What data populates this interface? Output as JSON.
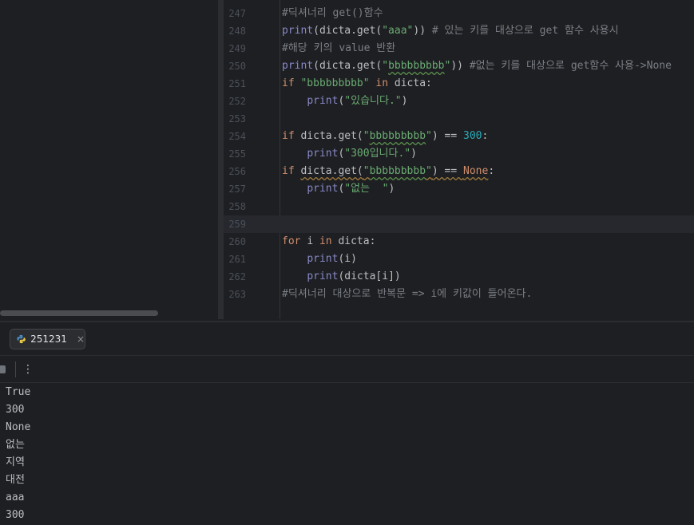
{
  "editor": {
    "lines": [
      {
        "n": "247",
        "tokens": [
          [
            "cm",
            "#딕셔너리 get()함수"
          ]
        ]
      },
      {
        "n": "248",
        "tokens": [
          [
            "fn",
            "print"
          ],
          [
            "",
            "(dicta.get("
          ],
          [
            "st",
            "\"aaa\""
          ],
          [
            "",
            ")) "
          ],
          [
            "cm",
            "# 있는 키를 대상으로 get 함수 사용시"
          ]
        ]
      },
      {
        "n": "249",
        "tokens": [
          [
            "cm",
            "#해당 키의 value 반환"
          ]
        ]
      },
      {
        "n": "250",
        "tokens": [
          [
            "fn",
            "print"
          ],
          [
            "",
            "(dicta.get("
          ],
          [
            "st",
            "\""
          ],
          [
            "st sq",
            "bbbbbbbbb"
          ],
          [
            "st",
            "\""
          ],
          [
            "",
            ")) "
          ],
          [
            "cm",
            "#없는 키를 대상으로 get함수 사용->None"
          ]
        ]
      },
      {
        "n": "251",
        "tokens": [
          [
            "kw",
            "if "
          ],
          [
            "st",
            "\"bbbbbbbbb\""
          ],
          [
            "kw",
            " in "
          ],
          [
            "",
            "dicta:"
          ]
        ]
      },
      {
        "n": "252",
        "tokens": [
          [
            "",
            "    "
          ],
          [
            "fn",
            "print"
          ],
          [
            "",
            "("
          ],
          [
            "st",
            "\"있습니다.\""
          ],
          [
            "",
            ")"
          ]
        ]
      },
      {
        "n": "253",
        "tokens": []
      },
      {
        "n": "254",
        "tokens": [
          [
            "kw",
            "if "
          ],
          [
            "",
            "dicta.get("
          ],
          [
            "st",
            "\""
          ],
          [
            "st sq",
            "bbbbbbbbb"
          ],
          [
            "st",
            "\""
          ],
          [
            "",
            ") == "
          ],
          [
            "nb",
            "300"
          ],
          [
            "",
            ":"
          ]
        ]
      },
      {
        "n": "255",
        "tokens": [
          [
            "",
            "    "
          ],
          [
            "fn",
            "print"
          ],
          [
            "",
            "("
          ],
          [
            "st",
            "\"300입니다.\""
          ],
          [
            "",
            ")"
          ]
        ]
      },
      {
        "n": "256",
        "tokens": [
          [
            "kw",
            "if "
          ],
          [
            "wq",
            "dicta.get("
          ],
          [
            "st wq",
            "\""
          ],
          [
            "st sq",
            "bbbbbbbbb"
          ],
          [
            "st wq",
            "\""
          ],
          [
            "wq",
            ") == "
          ],
          [
            "kw wq",
            "None"
          ],
          [
            "",
            ":"
          ]
        ]
      },
      {
        "n": "257",
        "tokens": [
          [
            "",
            "    "
          ],
          [
            "fn",
            "print"
          ],
          [
            "",
            "("
          ],
          [
            "st",
            "\"없는  \""
          ],
          [
            "",
            ")"
          ]
        ]
      },
      {
        "n": "258",
        "tokens": []
      },
      {
        "n": "259",
        "tokens": [],
        "current": true
      },
      {
        "n": "260",
        "tokens": [
          [
            "kw",
            "for "
          ],
          [
            "",
            "i"
          ],
          [
            "kw",
            " in "
          ],
          [
            "",
            "dicta:"
          ]
        ]
      },
      {
        "n": "261",
        "tokens": [
          [
            "",
            "    "
          ],
          [
            "fn",
            "print"
          ],
          [
            "",
            "(i)"
          ]
        ]
      },
      {
        "n": "262",
        "tokens": [
          [
            "",
            "    "
          ],
          [
            "fn",
            "print"
          ],
          [
            "",
            "(dicta[i])"
          ]
        ]
      },
      {
        "n": "263",
        "tokens": [
          [
            "cm",
            "#딕셔너리 대상으로 반복문 => i에 키값이 들어온다."
          ]
        ]
      }
    ]
  },
  "run": {
    "tab": {
      "label": "251231",
      "icon": "python-icon",
      "close": "×"
    },
    "toolbar": {
      "more": "⋮",
      "stop_icon": "stop-icon"
    },
    "console_lines": [
      "True",
      "300",
      "None",
      "없는",
      "지역",
      "대전",
      "aaa",
      "300"
    ]
  },
  "colors": {
    "background": "#1e1f22",
    "panel_border": "#2b2d30",
    "text": "#bcbec4",
    "comment": "#7a7e85",
    "builtin": "#8888c6",
    "string": "#6aab73",
    "keyword": "#cf8e6d",
    "number": "#2aacb8",
    "line_number": "#4b5059"
  }
}
